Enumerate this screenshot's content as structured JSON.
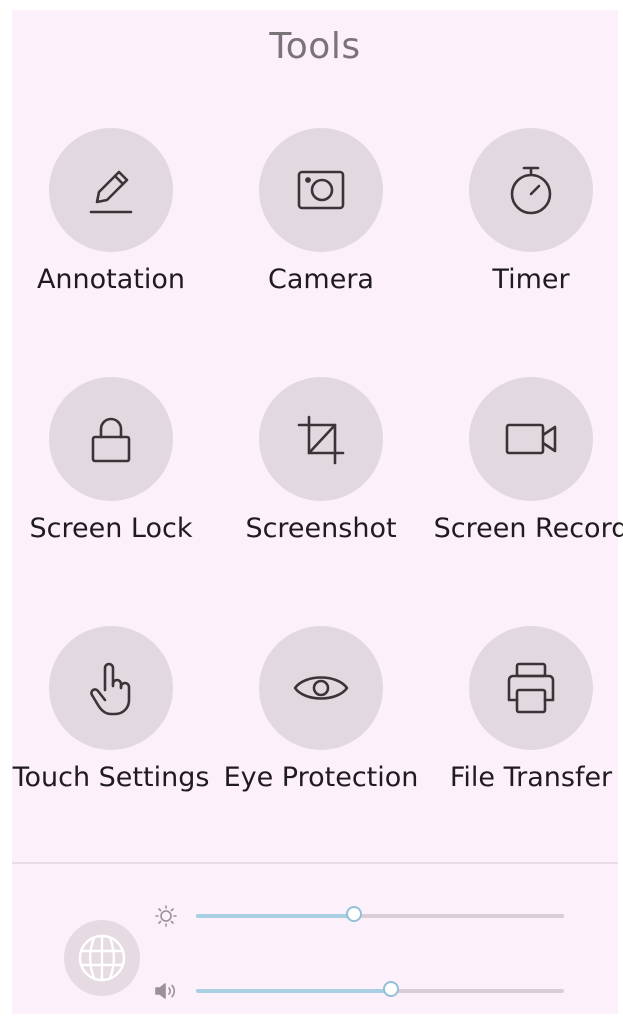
{
  "header": {
    "title": "Tools"
  },
  "tools": [
    {
      "label": "Annotation",
      "icon": "pencil-icon"
    },
    {
      "label": "Camera",
      "icon": "camera-icon"
    },
    {
      "label": "Timer",
      "icon": "stopwatch-icon"
    },
    {
      "label": "Screen Lock",
      "icon": "lock-icon"
    },
    {
      "label": "Screenshot",
      "icon": "crop-icon"
    },
    {
      "label": "Screen Record",
      "icon": "video-camera-icon"
    },
    {
      "label": "Touch Settings",
      "icon": "touch-hand-icon"
    },
    {
      "label": "Eye Protection",
      "icon": "eye-icon"
    },
    {
      "label": "File Transfer",
      "icon": "printer-icon"
    }
  ],
  "controls": {
    "mode_icon": "globe-icon",
    "brightness": {
      "icon": "brightness-icon",
      "level_percent": 43
    },
    "volume": {
      "icon": "volume-icon",
      "level_percent": 53
    }
  },
  "colors": {
    "panel_bg": "#fcf0fa",
    "circle_bg": "#e2d9e0",
    "slider_fill": "#a9cfe3",
    "slider_track": "#d9cdd6"
  }
}
